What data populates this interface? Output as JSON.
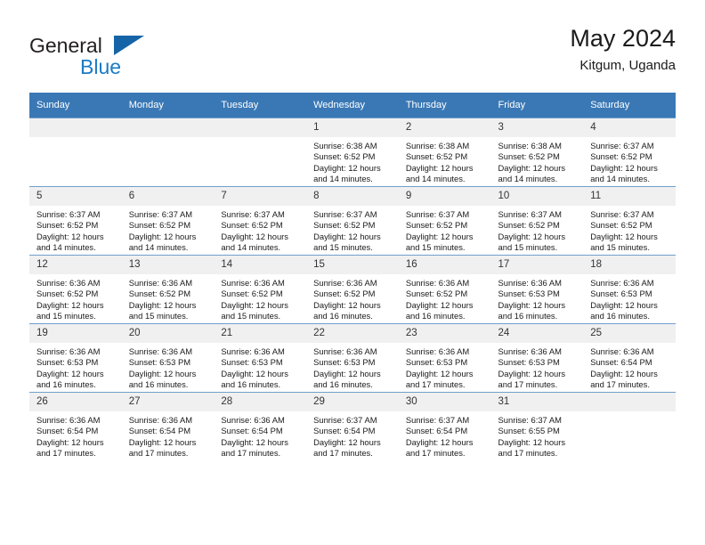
{
  "brand": {
    "name_part1": "General",
    "name_part2": "Blue",
    "triangle_color": "#1664a8",
    "blue_color": "#1a7bc4"
  },
  "header": {
    "title": "May 2024",
    "subtitle": "Kitgum, Uganda"
  },
  "theme": {
    "header_bg": "#3a78b5",
    "daynum_bg": "#f0f0f0",
    "row_divider": "#6f9fcb"
  },
  "weekday_headers": [
    "Sunday",
    "Monday",
    "Tuesday",
    "Wednesday",
    "Thursday",
    "Friday",
    "Saturday"
  ],
  "weeks": [
    [
      {
        "day": "",
        "empty": true,
        "sunrise": "",
        "sunset": "",
        "daylight_line1": "",
        "daylight_line2": ""
      },
      {
        "day": "",
        "empty": true,
        "sunrise": "",
        "sunset": "",
        "daylight_line1": "",
        "daylight_line2": ""
      },
      {
        "day": "",
        "empty": true,
        "sunrise": "",
        "sunset": "",
        "daylight_line1": "",
        "daylight_line2": ""
      },
      {
        "day": "1",
        "empty": false,
        "sunrise": "Sunrise: 6:38 AM",
        "sunset": "Sunset: 6:52 PM",
        "daylight_line1": "Daylight: 12 hours",
        "daylight_line2": "and 14 minutes."
      },
      {
        "day": "2",
        "empty": false,
        "sunrise": "Sunrise: 6:38 AM",
        "sunset": "Sunset: 6:52 PM",
        "daylight_line1": "Daylight: 12 hours",
        "daylight_line2": "and 14 minutes."
      },
      {
        "day": "3",
        "empty": false,
        "sunrise": "Sunrise: 6:38 AM",
        "sunset": "Sunset: 6:52 PM",
        "daylight_line1": "Daylight: 12 hours",
        "daylight_line2": "and 14 minutes."
      },
      {
        "day": "4",
        "empty": false,
        "sunrise": "Sunrise: 6:37 AM",
        "sunset": "Sunset: 6:52 PM",
        "daylight_line1": "Daylight: 12 hours",
        "daylight_line2": "and 14 minutes."
      }
    ],
    [
      {
        "day": "5",
        "empty": false,
        "sunrise": "Sunrise: 6:37 AM",
        "sunset": "Sunset: 6:52 PM",
        "daylight_line1": "Daylight: 12 hours",
        "daylight_line2": "and 14 minutes."
      },
      {
        "day": "6",
        "empty": false,
        "sunrise": "Sunrise: 6:37 AM",
        "sunset": "Sunset: 6:52 PM",
        "daylight_line1": "Daylight: 12 hours",
        "daylight_line2": "and 14 minutes."
      },
      {
        "day": "7",
        "empty": false,
        "sunrise": "Sunrise: 6:37 AM",
        "sunset": "Sunset: 6:52 PM",
        "daylight_line1": "Daylight: 12 hours",
        "daylight_line2": "and 14 minutes."
      },
      {
        "day": "8",
        "empty": false,
        "sunrise": "Sunrise: 6:37 AM",
        "sunset": "Sunset: 6:52 PM",
        "daylight_line1": "Daylight: 12 hours",
        "daylight_line2": "and 15 minutes."
      },
      {
        "day": "9",
        "empty": false,
        "sunrise": "Sunrise: 6:37 AM",
        "sunset": "Sunset: 6:52 PM",
        "daylight_line1": "Daylight: 12 hours",
        "daylight_line2": "and 15 minutes."
      },
      {
        "day": "10",
        "empty": false,
        "sunrise": "Sunrise: 6:37 AM",
        "sunset": "Sunset: 6:52 PM",
        "daylight_line1": "Daylight: 12 hours",
        "daylight_line2": "and 15 minutes."
      },
      {
        "day": "11",
        "empty": false,
        "sunrise": "Sunrise: 6:37 AM",
        "sunset": "Sunset: 6:52 PM",
        "daylight_line1": "Daylight: 12 hours",
        "daylight_line2": "and 15 minutes."
      }
    ],
    [
      {
        "day": "12",
        "empty": false,
        "sunrise": "Sunrise: 6:36 AM",
        "sunset": "Sunset: 6:52 PM",
        "daylight_line1": "Daylight: 12 hours",
        "daylight_line2": "and 15 minutes."
      },
      {
        "day": "13",
        "empty": false,
        "sunrise": "Sunrise: 6:36 AM",
        "sunset": "Sunset: 6:52 PM",
        "daylight_line1": "Daylight: 12 hours",
        "daylight_line2": "and 15 minutes."
      },
      {
        "day": "14",
        "empty": false,
        "sunrise": "Sunrise: 6:36 AM",
        "sunset": "Sunset: 6:52 PM",
        "daylight_line1": "Daylight: 12 hours",
        "daylight_line2": "and 15 minutes."
      },
      {
        "day": "15",
        "empty": false,
        "sunrise": "Sunrise: 6:36 AM",
        "sunset": "Sunset: 6:52 PM",
        "daylight_line1": "Daylight: 12 hours",
        "daylight_line2": "and 16 minutes."
      },
      {
        "day": "16",
        "empty": false,
        "sunrise": "Sunrise: 6:36 AM",
        "sunset": "Sunset: 6:52 PM",
        "daylight_line1": "Daylight: 12 hours",
        "daylight_line2": "and 16 minutes."
      },
      {
        "day": "17",
        "empty": false,
        "sunrise": "Sunrise: 6:36 AM",
        "sunset": "Sunset: 6:53 PM",
        "daylight_line1": "Daylight: 12 hours",
        "daylight_line2": "and 16 minutes."
      },
      {
        "day": "18",
        "empty": false,
        "sunrise": "Sunrise: 6:36 AM",
        "sunset": "Sunset: 6:53 PM",
        "daylight_line1": "Daylight: 12 hours",
        "daylight_line2": "and 16 minutes."
      }
    ],
    [
      {
        "day": "19",
        "empty": false,
        "sunrise": "Sunrise: 6:36 AM",
        "sunset": "Sunset: 6:53 PM",
        "daylight_line1": "Daylight: 12 hours",
        "daylight_line2": "and 16 minutes."
      },
      {
        "day": "20",
        "empty": false,
        "sunrise": "Sunrise: 6:36 AM",
        "sunset": "Sunset: 6:53 PM",
        "daylight_line1": "Daylight: 12 hours",
        "daylight_line2": "and 16 minutes."
      },
      {
        "day": "21",
        "empty": false,
        "sunrise": "Sunrise: 6:36 AM",
        "sunset": "Sunset: 6:53 PM",
        "daylight_line1": "Daylight: 12 hours",
        "daylight_line2": "and 16 minutes."
      },
      {
        "day": "22",
        "empty": false,
        "sunrise": "Sunrise: 6:36 AM",
        "sunset": "Sunset: 6:53 PM",
        "daylight_line1": "Daylight: 12 hours",
        "daylight_line2": "and 16 minutes."
      },
      {
        "day": "23",
        "empty": false,
        "sunrise": "Sunrise: 6:36 AM",
        "sunset": "Sunset: 6:53 PM",
        "daylight_line1": "Daylight: 12 hours",
        "daylight_line2": "and 17 minutes."
      },
      {
        "day": "24",
        "empty": false,
        "sunrise": "Sunrise: 6:36 AM",
        "sunset": "Sunset: 6:53 PM",
        "daylight_line1": "Daylight: 12 hours",
        "daylight_line2": "and 17 minutes."
      },
      {
        "day": "25",
        "empty": false,
        "sunrise": "Sunrise: 6:36 AM",
        "sunset": "Sunset: 6:54 PM",
        "daylight_line1": "Daylight: 12 hours",
        "daylight_line2": "and 17 minutes."
      }
    ],
    [
      {
        "day": "26",
        "empty": false,
        "sunrise": "Sunrise: 6:36 AM",
        "sunset": "Sunset: 6:54 PM",
        "daylight_line1": "Daylight: 12 hours",
        "daylight_line2": "and 17 minutes."
      },
      {
        "day": "27",
        "empty": false,
        "sunrise": "Sunrise: 6:36 AM",
        "sunset": "Sunset: 6:54 PM",
        "daylight_line1": "Daylight: 12 hours",
        "daylight_line2": "and 17 minutes."
      },
      {
        "day": "28",
        "empty": false,
        "sunrise": "Sunrise: 6:36 AM",
        "sunset": "Sunset: 6:54 PM",
        "daylight_line1": "Daylight: 12 hours",
        "daylight_line2": "and 17 minutes."
      },
      {
        "day": "29",
        "empty": false,
        "sunrise": "Sunrise: 6:37 AM",
        "sunset": "Sunset: 6:54 PM",
        "daylight_line1": "Daylight: 12 hours",
        "daylight_line2": "and 17 minutes."
      },
      {
        "day": "30",
        "empty": false,
        "sunrise": "Sunrise: 6:37 AM",
        "sunset": "Sunset: 6:54 PM",
        "daylight_line1": "Daylight: 12 hours",
        "daylight_line2": "and 17 minutes."
      },
      {
        "day": "31",
        "empty": false,
        "sunrise": "Sunrise: 6:37 AM",
        "sunset": "Sunset: 6:55 PM",
        "daylight_line1": "Daylight: 12 hours",
        "daylight_line2": "and 17 minutes."
      },
      {
        "day": "",
        "empty": true,
        "sunrise": "",
        "sunset": "",
        "daylight_line1": "",
        "daylight_line2": ""
      }
    ]
  ]
}
